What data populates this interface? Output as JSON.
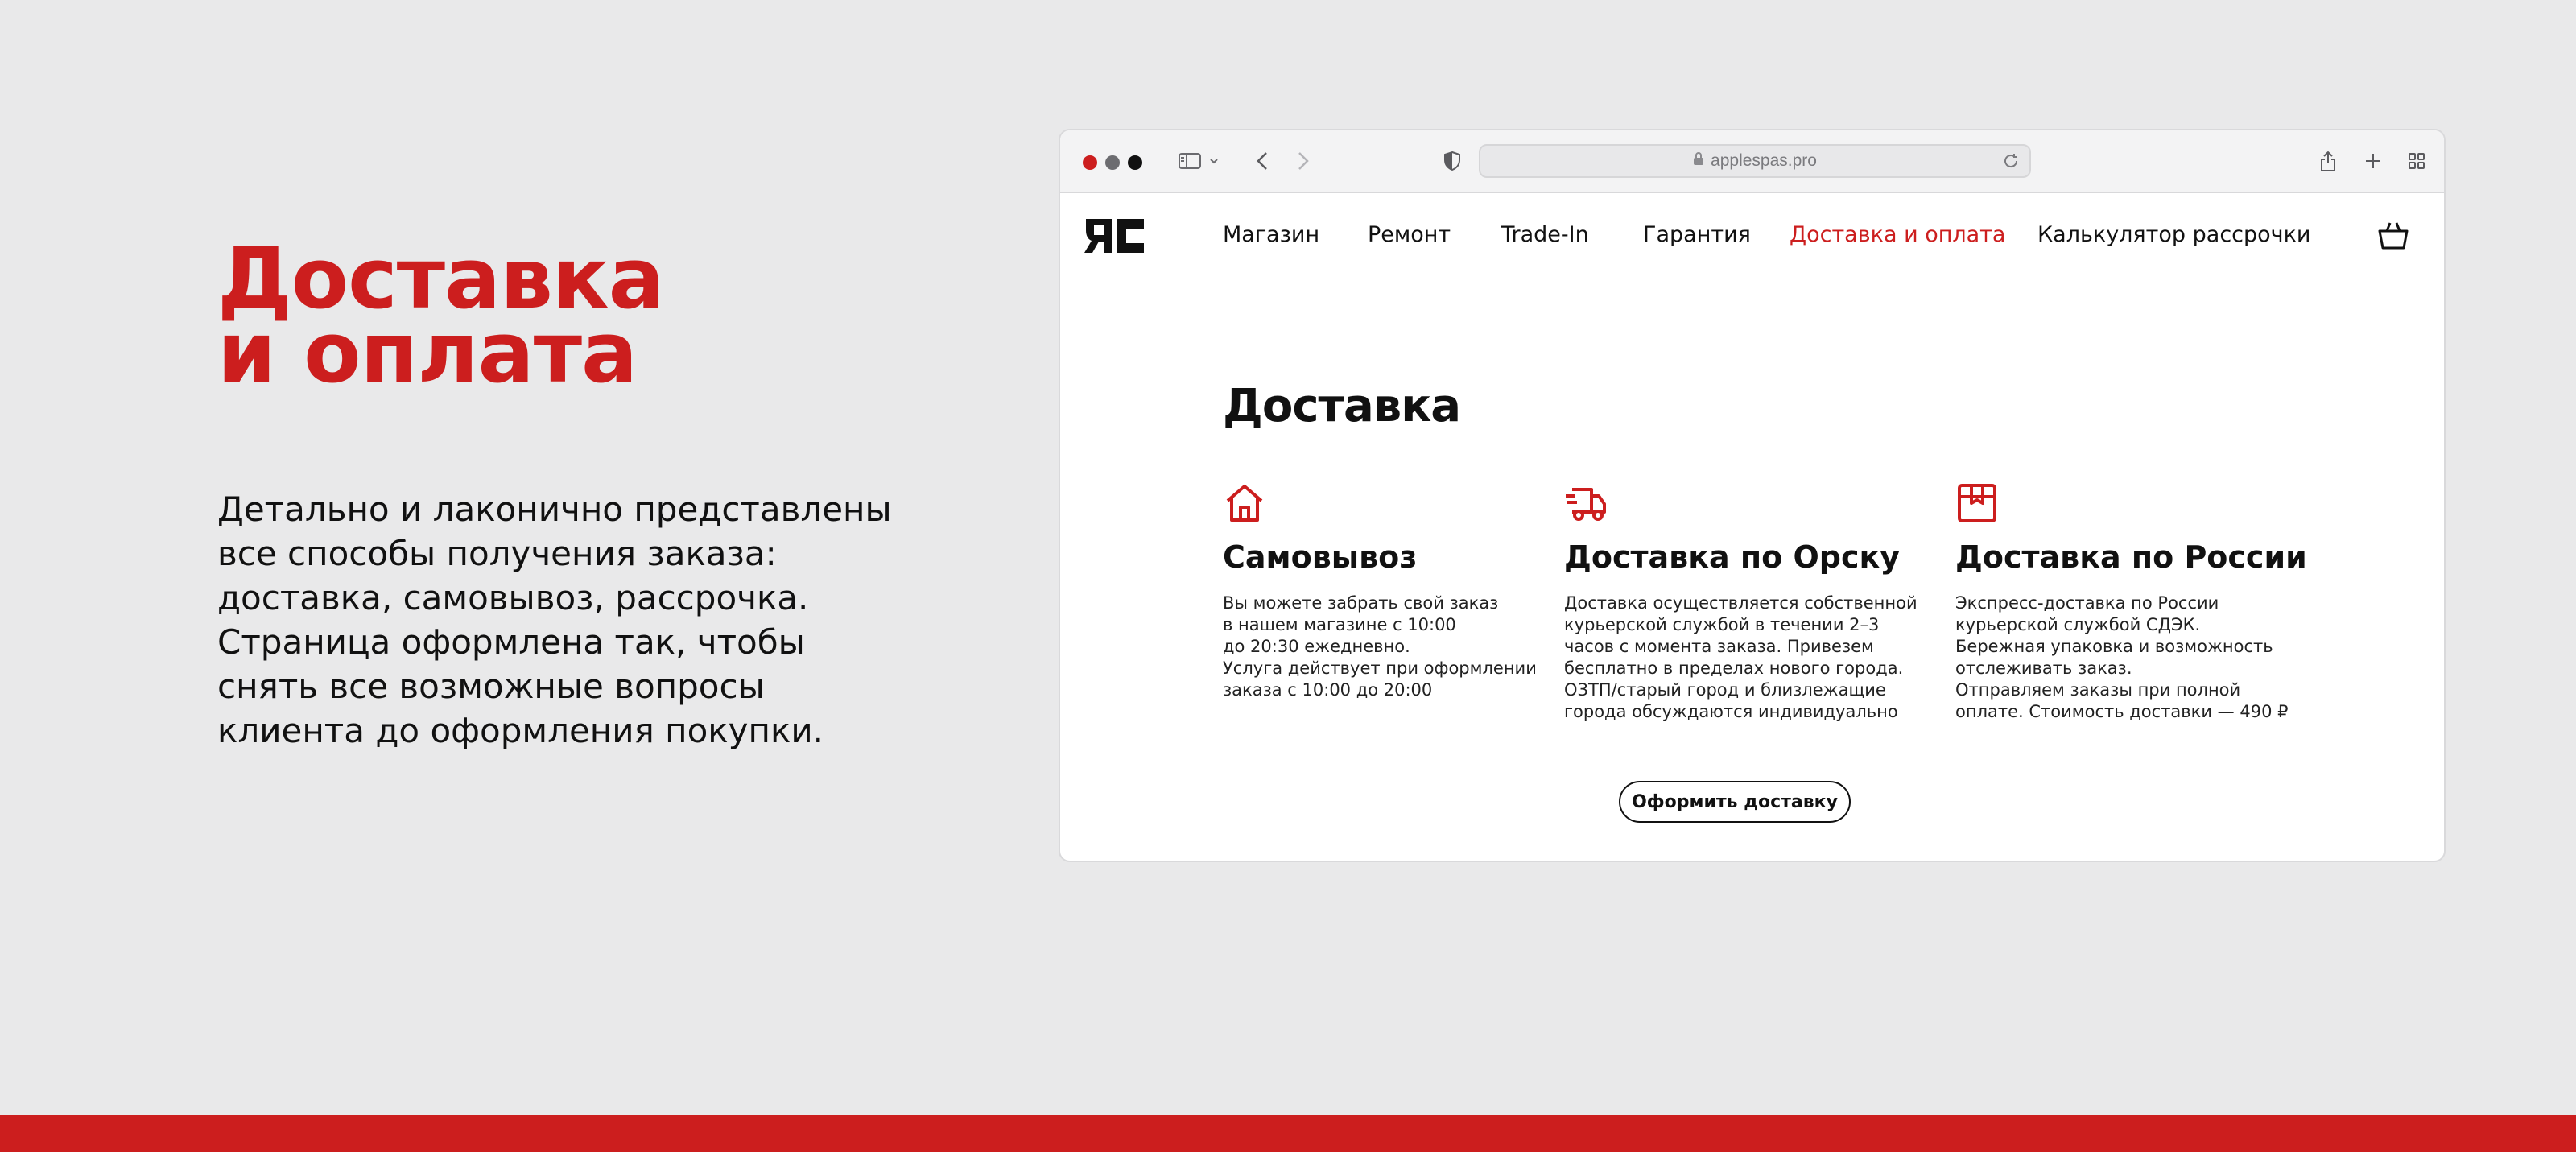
{
  "promo": {
    "title_line1": "Доставка",
    "title_line2": "и оплата",
    "description_lines": [
      "Детально и лаконично представлены",
      "все способы получения заказа:",
      "доставка, самовывоз, рассрочка.",
      "Страница оформлена так, чтобы",
      "снять все возможные вопросы",
      "клиента до оформления покупки."
    ]
  },
  "browser": {
    "url": "applespas.pro"
  },
  "site": {
    "nav": [
      "Магазин",
      "Ремонт",
      "Trade-In",
      "Гарантия",
      "Доставка и оплата",
      "Калькулятор рассрочки"
    ],
    "active_nav": "Доставка и оплата"
  },
  "content": {
    "title": "Доставка",
    "columns": [
      {
        "icon": "home-icon",
        "title": "Самовывоз",
        "lines": [
          "Вы можете забрать свой заказ",
          "в нашем магазине с 10:00",
          "до 20:30 ежедневно.",
          "Услуга действует при оформлении",
          "заказа с 10:00 до 20:00"
        ]
      },
      {
        "icon": "truck-icon",
        "title": "Доставка по Орску",
        "lines": [
          "Доставка осуществляется собственной",
          "курьерской службой в течении 2–3",
          "часов с момента заказа. Привезем",
          "бесплатно в пределах нового города.",
          "ОЗТП/старый город и близлежащие",
          "города обсуждаются индивидуально"
        ]
      },
      {
        "icon": "package-icon",
        "title": "Доставка по России",
        "lines": [
          "Экспресс-доставка по России",
          "курьерской службой СДЭК.",
          "Бережная упаковка и возможность",
          "отслеживать заказ.",
          "Отправляем заказы при полной",
          "оплате. Стоимость доставки — 490 ₽"
        ]
      }
    ],
    "cta_label": "Оформить доставку"
  },
  "colors": {
    "accent": "#cc1e1e",
    "background": "#e9e9ea",
    "text": "#111111"
  }
}
